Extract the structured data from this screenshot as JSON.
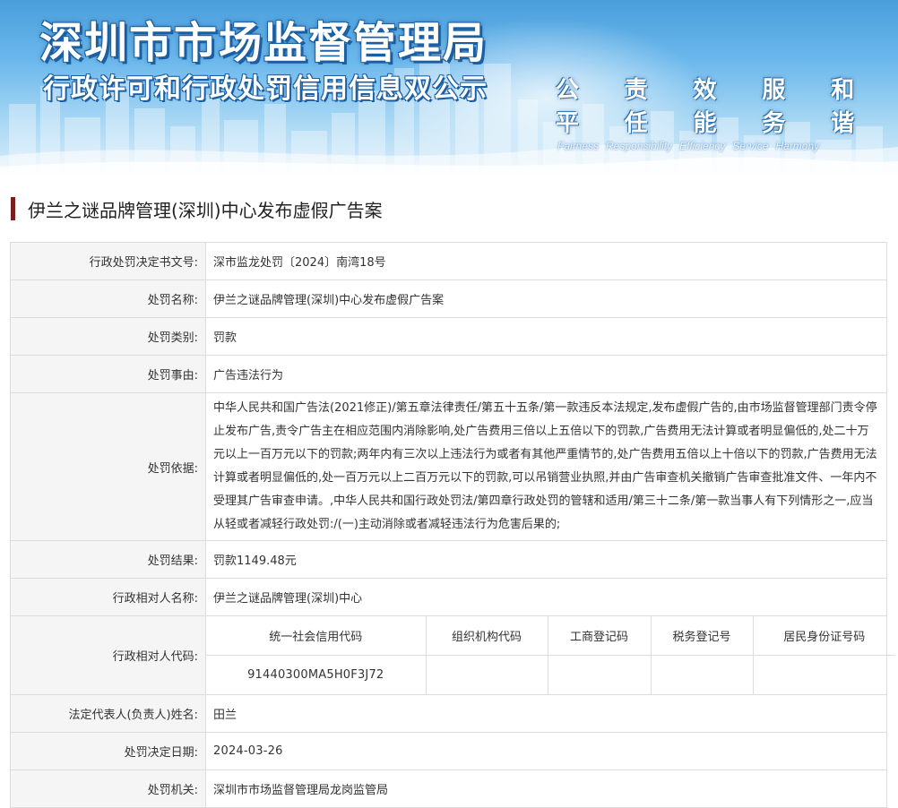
{
  "banner": {
    "title": "深圳市市场监督管理局",
    "subtitle": "行政许可和行政处罚信用信息双公示",
    "motto_cn": [
      "公平",
      "责任",
      "效能",
      "服务",
      "和谐"
    ],
    "motto_en": [
      "Fairness",
      "Responsibility",
      "Efficiency",
      "Service",
      "Harmony"
    ]
  },
  "case_title": "伊兰之谜品牌管理(深圳)中心发布虚假广告案",
  "fields": {
    "doc_no": {
      "label": "行政处罚决定书文号:",
      "value": "深市监龙处罚〔2024〕南湾18号"
    },
    "name": {
      "label": "处罚名称:",
      "value": "伊兰之谜品牌管理(深圳)中心发布虚假广告案"
    },
    "category": {
      "label": "处罚类别:",
      "value": "罚款"
    },
    "cause": {
      "label": "处罚事由:",
      "value": "广告违法行为"
    },
    "basis": {
      "label": "处罚依据:",
      "value": "中华人民共和国广告法(2021修正)/第五章法律责任/第五十五条/第一款违反本法规定,发布虚假广告的,由市场监督管理部门责令停止发布广告,责令广告主在相应范围内消除影响,处广告费用三倍以上五倍以下的罚款,广告费用无法计算或者明显偏低的,处二十万元以上一百万元以下的罚款;两年内有三次以上违法行为或者有其他严重情节的,处广告费用五倍以上十倍以下的罚款,广告费用无法计算或者明显偏低的,处一百万元以上二百万元以下的罚款,可以吊销营业执照,并由广告审查机关撤销广告审查批准文件、一年内不受理其广告审查申请。,中华人民共和国行政处罚法/第四章行政处罚的管辖和适用/第三十二条/第一款当事人有下列情形之一,应当从轻或者减轻行政处罚:/(一)主动消除或者减轻违法行为危害后果的;"
    },
    "result": {
      "label": "处罚结果:",
      "value": "罚款1149.48元"
    },
    "party_name": {
      "label": "行政相对人名称:",
      "value": "伊兰之谜品牌管理(深圳)中心"
    },
    "party_code": {
      "label": "行政相对人代码:",
      "headers": [
        "统一社会信用代码",
        "组织机构代码",
        "工商登记码",
        "税务登记号",
        "居民身份证号码"
      ],
      "values": [
        "91440300MA5H0F3J72",
        "",
        "",
        "",
        ""
      ]
    },
    "legal_rep": {
      "label": "法定代表人(负责人)姓名:",
      "value": "田兰"
    },
    "date": {
      "label": "处罚决定日期:",
      "value": "2024-03-26"
    },
    "authority": {
      "label": "处罚机关:",
      "value": "深圳市市场监督管理局龙岗监管局"
    }
  },
  "colors": {
    "banner_top": "#4a9fdc",
    "title_stroke": "#1b5fa3",
    "title_bar": "#7a1e1e",
    "label_bg": "#f5f5f5",
    "border": "#dcdcdc"
  }
}
